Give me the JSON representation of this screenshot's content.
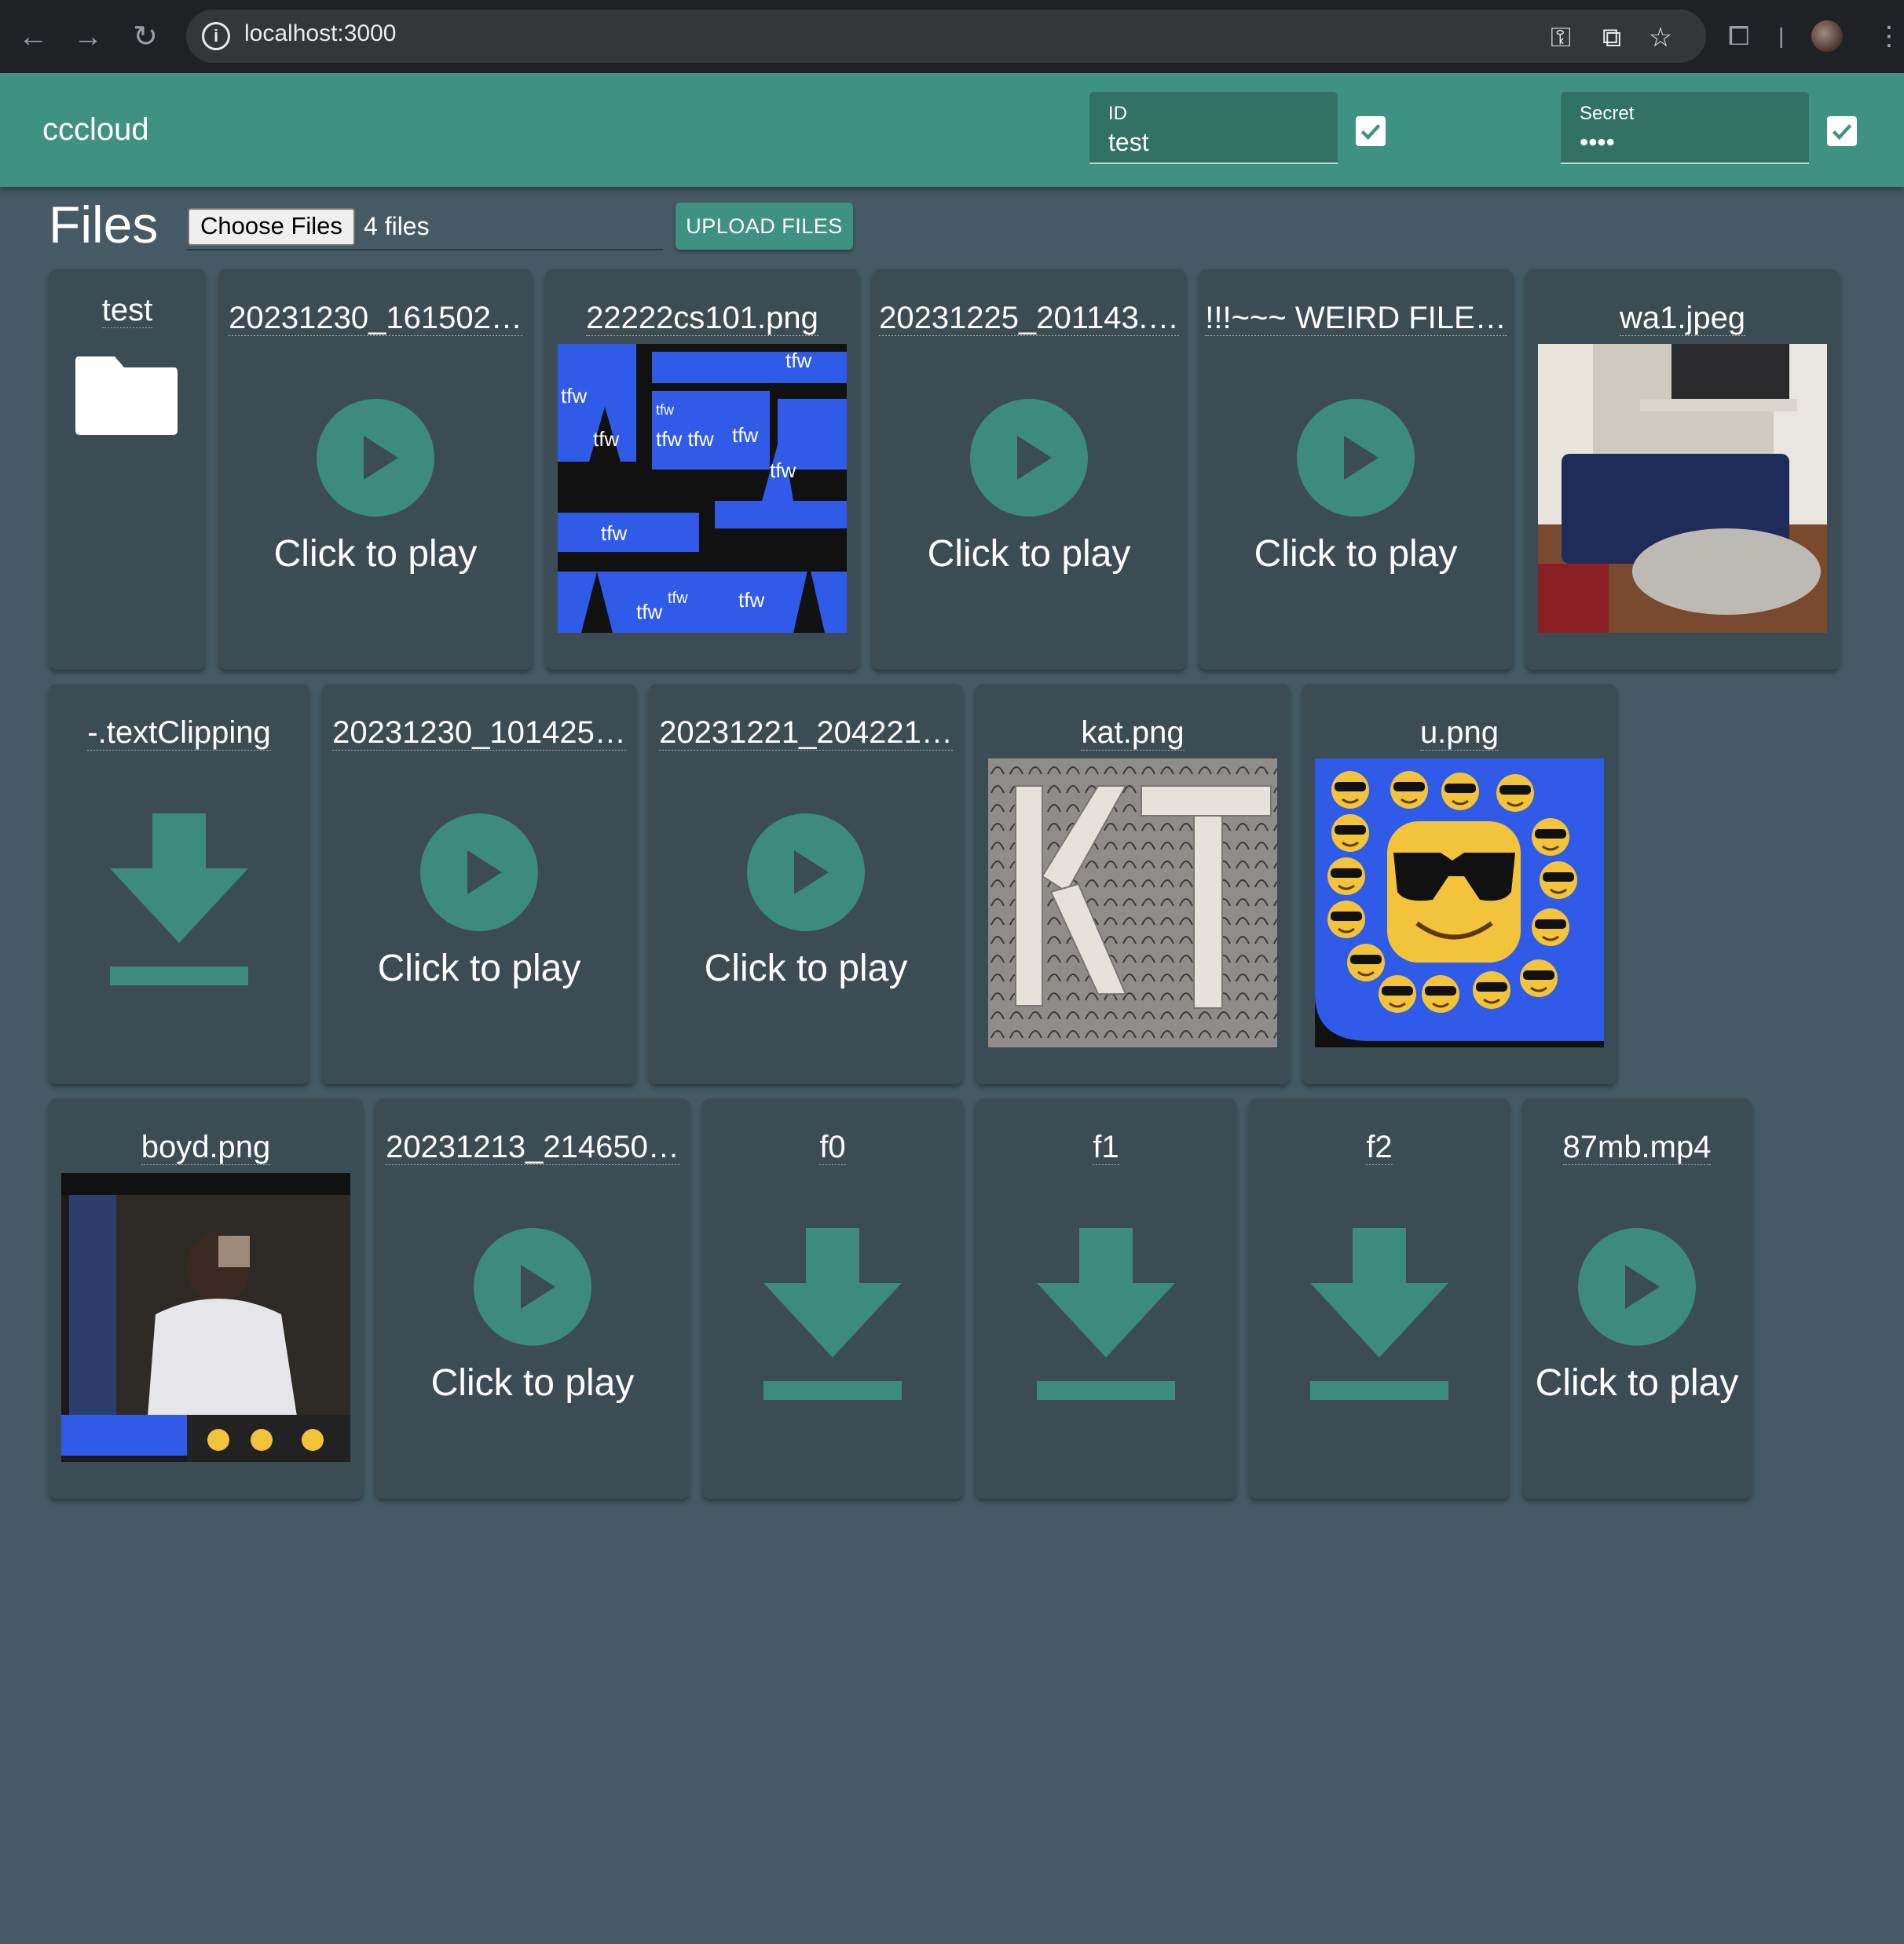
{
  "browser": {
    "url": "localhost:3000"
  },
  "appbar": {
    "brand": "cccloud",
    "id_field": {
      "label": "ID",
      "value": "test",
      "checked": true
    },
    "secret_field": {
      "label": "Secret",
      "value": "••••",
      "checked": true
    }
  },
  "files_section": {
    "title": "Files",
    "choose_label": "Choose Files",
    "file_count": "4 files",
    "upload_label": "UPLOAD FILES"
  },
  "play_label": "Click to play",
  "rows": [
    [
      {
        "name": "test",
        "kind": "folder"
      },
      {
        "name": "20231230_161502…",
        "kind": "video"
      },
      {
        "name": "22222cs101.png",
        "kind": "image",
        "preview": "tfw-collage"
      },
      {
        "name": "20231225_201143.…",
        "kind": "video"
      },
      {
        "name": "!!!~~~ WEIRD FILE…",
        "kind": "video"
      },
      {
        "name": "wa1.jpeg",
        "kind": "image",
        "preview": "room-photo"
      }
    ],
    [
      {
        "name": "-.textClipping",
        "kind": "download"
      },
      {
        "name": "20231230_101425…",
        "kind": "video"
      },
      {
        "name": "20231221_204221…",
        "kind": "video"
      },
      {
        "name": "kat.png",
        "kind": "image",
        "preview": "kt-pattern"
      },
      {
        "name": "u.png",
        "kind": "image",
        "preview": "sunglasses-emoji"
      }
    ],
    [
      {
        "name": "boyd.png",
        "kind": "image",
        "preview": "screenshot-photo"
      },
      {
        "name": "20231213_214650…",
        "kind": "video"
      },
      {
        "name": "f0",
        "kind": "download"
      },
      {
        "name": "f1",
        "kind": "download"
      },
      {
        "name": "f2",
        "kind": "download"
      },
      {
        "name": "87mb.mp4",
        "kind": "video"
      }
    ]
  ],
  "colors": {
    "page_bg": "#455a64",
    "appbar": "#3f9282",
    "card": "#3b4c55",
    "accent": "#3d8b7d",
    "image_blue": "#2f5be8"
  }
}
